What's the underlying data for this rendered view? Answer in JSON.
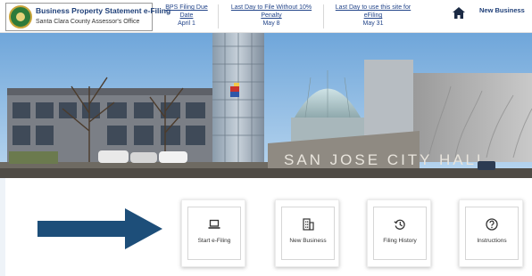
{
  "brand": {
    "title": "Business Property Statement e-Filing",
    "subtitle": "Santa Clara County Assessor's Office"
  },
  "deadlines": [
    {
      "label_line1": "BPS Filing Due",
      "label_line2": "Date",
      "date": "April 1"
    },
    {
      "label_line1": "Last Day to File Without 10%",
      "label_line2": "Penalty",
      "date": "May 8"
    },
    {
      "label_line1": "Last Day to use this site for",
      "label_line2": "eFiling",
      "date": "May 31"
    }
  ],
  "nav": {
    "home_icon": "home-icon",
    "new_business_label": "New Business"
  },
  "hero": {
    "building_sign": "SAN JOSE CITY HALL"
  },
  "cards": [
    {
      "label": "Start e-Filing",
      "icon": "laptop-icon"
    },
    {
      "label": "New Business",
      "icon": "building-icon"
    },
    {
      "label": "Filing History",
      "icon": "history-icon"
    },
    {
      "label": "Instructions",
      "icon": "question-icon"
    }
  ],
  "colors": {
    "arrow": "#1d4e79",
    "brand_text": "#1e3f78",
    "link": "#23458a"
  }
}
